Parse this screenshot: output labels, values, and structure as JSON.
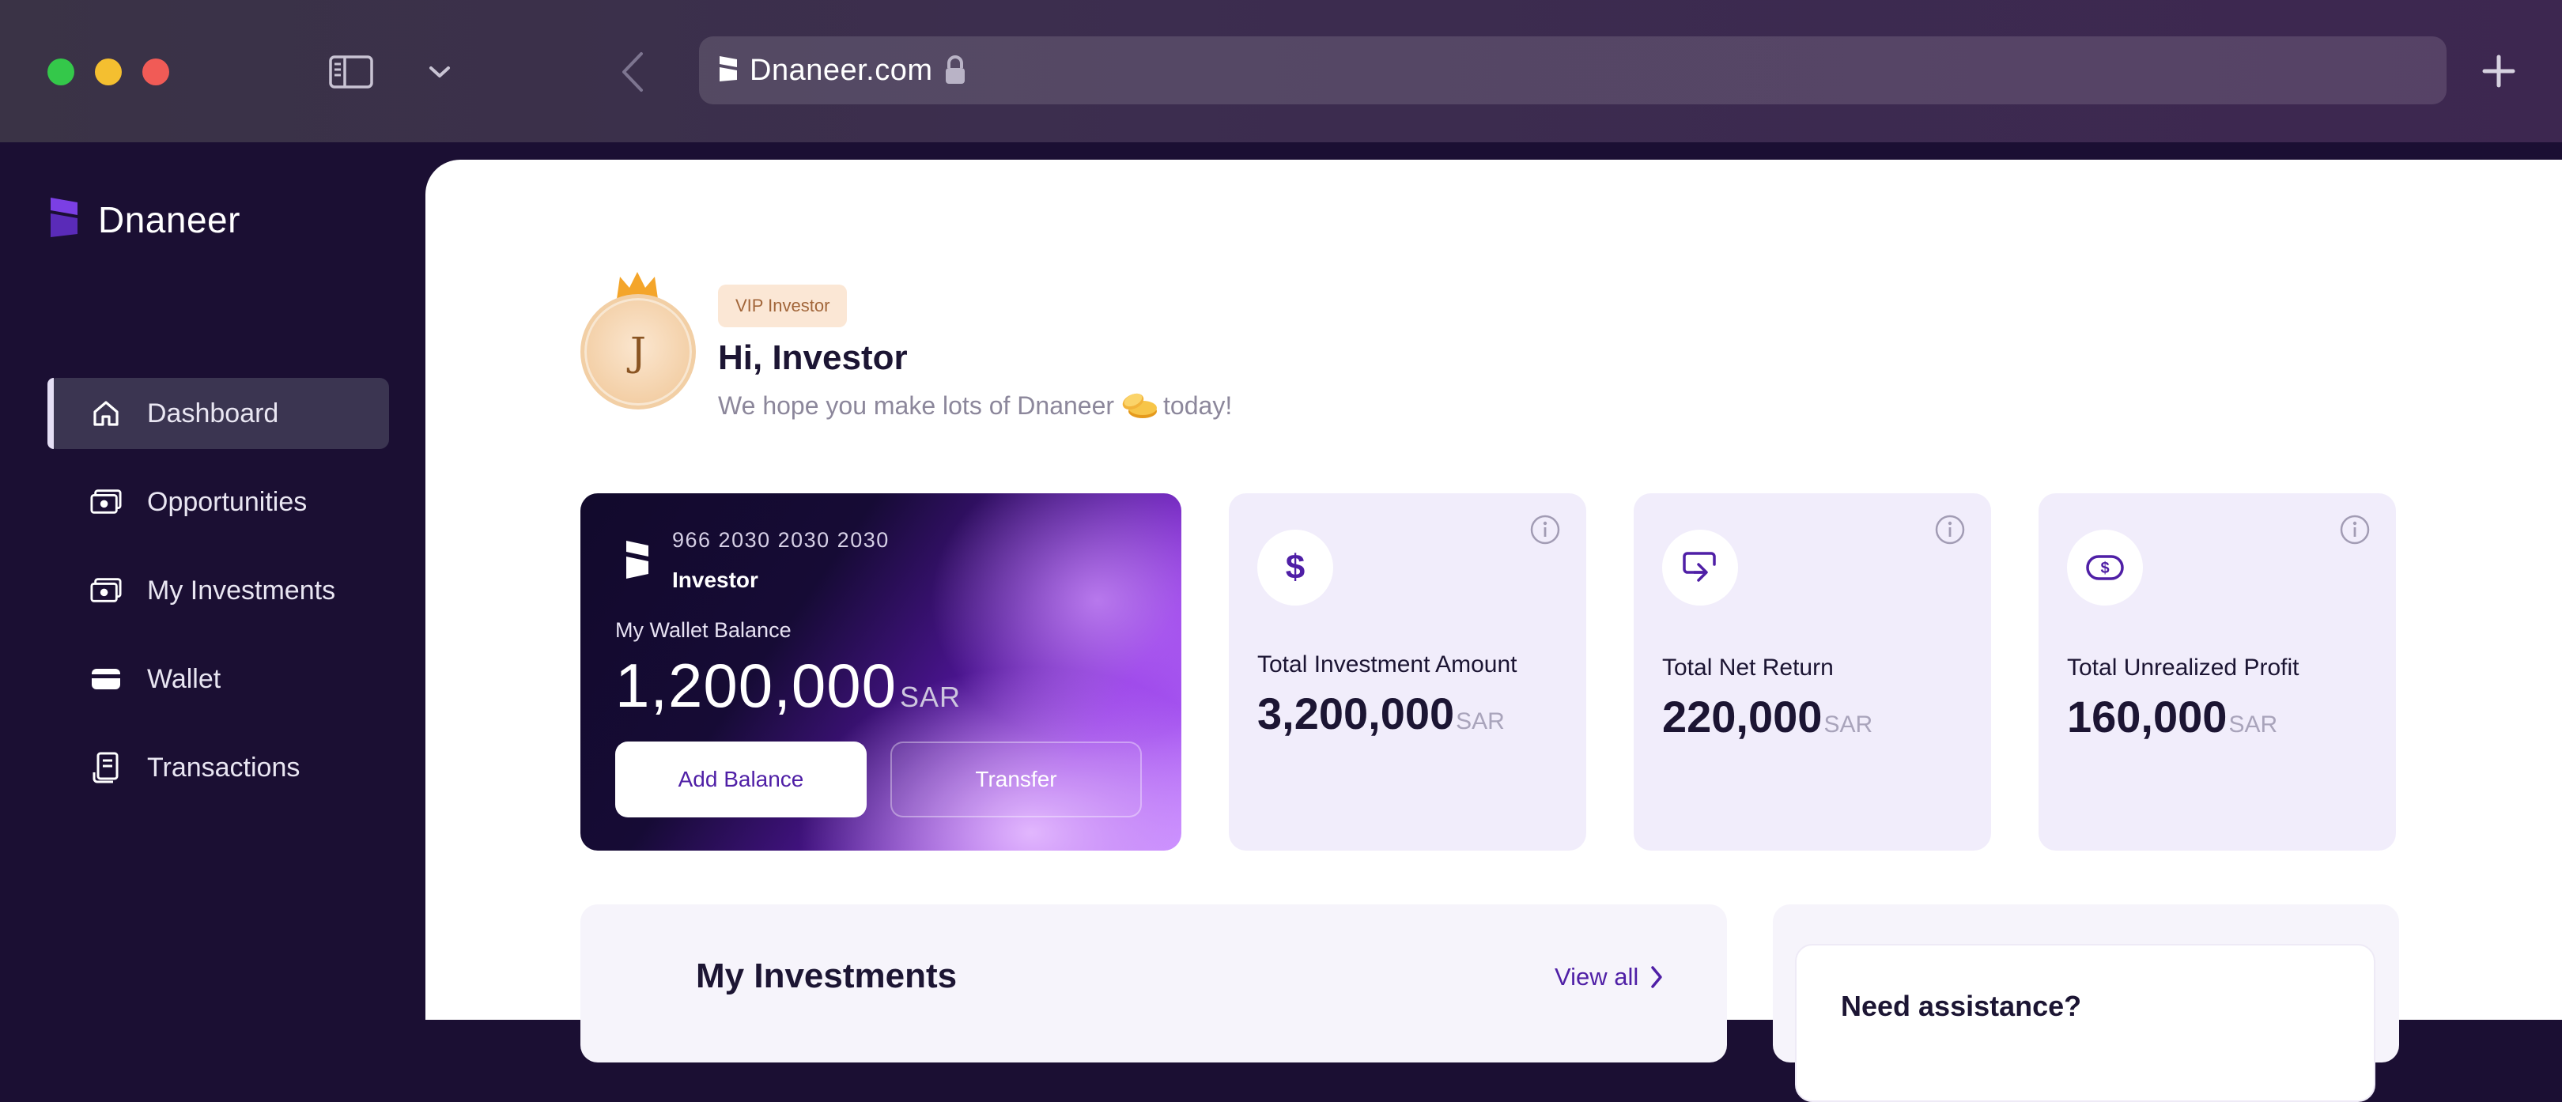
{
  "browser": {
    "url": "Dnaneer.com",
    "icons": [
      "sidebar-toggle-icon",
      "chevron-down-icon",
      "back-arrow-icon",
      "site-favicon-icon",
      "lock-icon",
      "plus-icon"
    ]
  },
  "sidebar": {
    "brand": "Dnaneer",
    "items": [
      {
        "label": "Dashboard",
        "icon": "home-icon",
        "active": true
      },
      {
        "label": "Opportunities",
        "icon": "cash-icon",
        "active": false
      },
      {
        "label": "My Investments",
        "icon": "cash-icon",
        "active": false
      },
      {
        "label": "Wallet",
        "icon": "wallet-icon",
        "active": false
      },
      {
        "label": "Transactions",
        "icon": "receipt-icon",
        "active": false
      }
    ]
  },
  "header": {
    "avatar_letter": "J",
    "badge": "VIP Investor",
    "greeting": "Hi, Investor",
    "sub_before": "We hope you make lots of Dnaneer",
    "sub_after": "today!"
  },
  "wallet": {
    "card_number": "966 2030 2030 2030",
    "holder": "Investor",
    "label": "My Wallet Balance",
    "amount": "1,200,000",
    "currency": "SAR",
    "add_balance": "Add Balance",
    "transfer": "Transfer"
  },
  "stats": [
    {
      "label": "Total Investment Amount",
      "value": "3,200,000",
      "currency": "SAR",
      "icon": "dollar-icon"
    },
    {
      "label": "Total Net Return",
      "value": "220,000",
      "currency": "SAR",
      "icon": "return-arrow-icon"
    },
    {
      "label": "Total Unrealized Profit",
      "value": "160,000",
      "currency": "SAR",
      "icon": "money-bill-icon"
    }
  ],
  "investments": {
    "title": "My Investments",
    "view_all": "View all"
  },
  "assistance": {
    "title": "Need assistance?"
  },
  "colors": {
    "sidebar_bg": "#1b0f33",
    "accent": "#4f1fa6",
    "stat_card_bg": "#f1edfb",
    "badge_bg": "#fbe7d5"
  }
}
